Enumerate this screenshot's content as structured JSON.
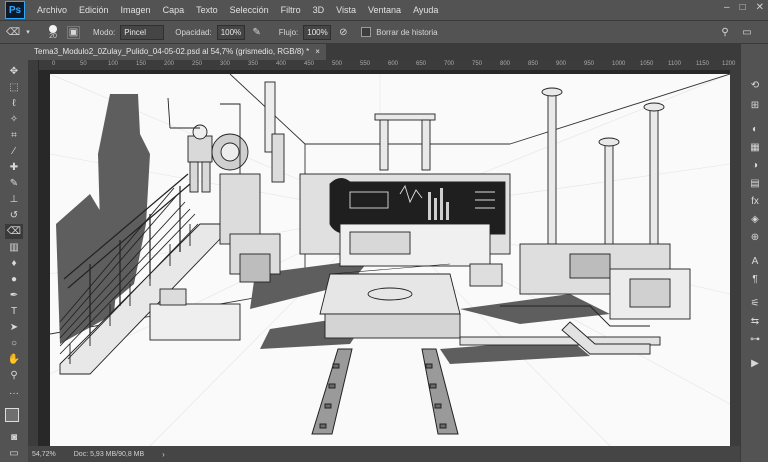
{
  "app": {
    "logo": "Ps"
  },
  "menu": [
    "Archivo",
    "Edición",
    "Imagen",
    "Capa",
    "Texto",
    "Selección",
    "Filtro",
    "3D",
    "Vista",
    "Ventana",
    "Ayuda"
  ],
  "options": {
    "brush_size": "20",
    "mode_label": "Modo:",
    "mode_value": "Pincel",
    "opacity_label": "Opacidad:",
    "opacity_value": "100%",
    "flow_label": "Flujo:",
    "flow_value": "100%",
    "history_label": "Borrar de historia"
  },
  "document": {
    "tab_title": "Tema3_Modulo2_0Zulay_Pulido_04-05-02.psd al 54,7% (grismedio, RGB/8) *",
    "close": "×"
  },
  "ruler": [
    "0",
    "50",
    "100",
    "150",
    "200",
    "250",
    "300",
    "350",
    "400",
    "450",
    "500",
    "550",
    "600",
    "650",
    "700",
    "750",
    "800",
    "850",
    "900",
    "950",
    "1000",
    "1050",
    "1100",
    "1150",
    "1200"
  ],
  "status": {
    "zoom": "54,72%",
    "doc": "Doc: 5,93 MB/90,8 MB"
  },
  "tools": [
    "move-tool",
    "marquee-tool",
    "lasso-tool",
    "magic-wand-tool",
    "crop-tool",
    "eyedropper-tool",
    "healing-tool",
    "brush-tool",
    "stamp-tool",
    "history-brush-tool",
    "eraser-tool",
    "gradient-tool",
    "blur-tool",
    "dodge-tool",
    "pen-tool",
    "type-tool",
    "path-select-tool",
    "shape-tool",
    "hand-tool",
    "zoom-tool",
    "more-tools"
  ],
  "panels": [
    "history-panel",
    "color-panel",
    "swatches-panel",
    "adjustments-panel",
    "libraries-panel",
    "layers-panel",
    "channels-panel",
    "paths-panel",
    "properties-panel",
    "character-panel",
    "paragraph-panel",
    "play-button"
  ]
}
